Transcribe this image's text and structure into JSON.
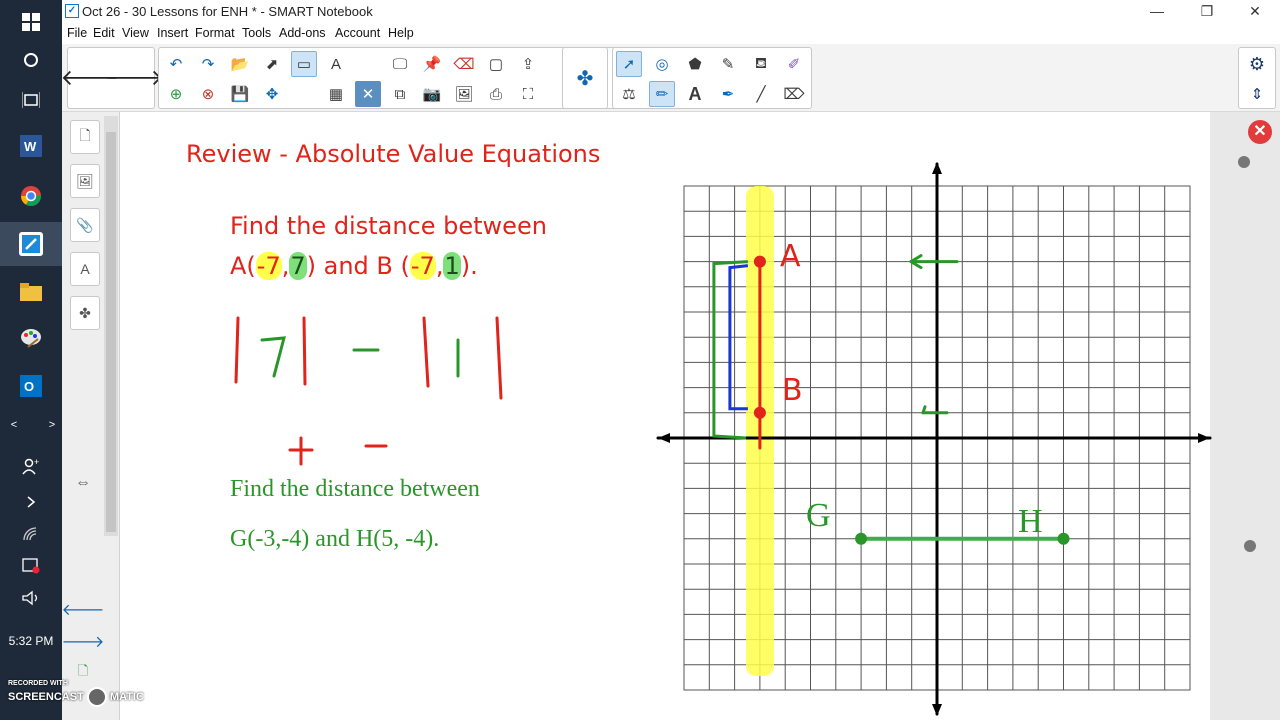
{
  "window": {
    "title": "Oct 26 - 30 Lessons for ENH * - SMART Notebook",
    "minimize": "—",
    "restore": "❐",
    "close": "✕"
  },
  "menu": [
    "File",
    "Edit",
    "View",
    "Insert",
    "Format",
    "Tools",
    "Add-ons",
    "Account",
    "Help"
  ],
  "taskbar": {
    "time": "5:32 PM"
  },
  "lesson": {
    "heading": "Review - Absolute Value Equations",
    "q1_line1": "Find the distance between",
    "q1_A_prefix": "A(",
    "q1_A_x": "-7",
    "q1_A_y": "7",
    "q1_A_mid": ") and B (",
    "q1_B_x": "-7",
    "q1_B_y": "1",
    "q1_B_suffix": ").",
    "q2_line1": "Find the distance between",
    "q2_line2": "G(-3,-4) and H(5, -4)."
  },
  "graph": {
    "point_labels": {
      "A": "A",
      "B": "B",
      "G": "G",
      "H": "H"
    },
    "points": {
      "A": [
        -7,
        7
      ],
      "B": [
        -7,
        1
      ],
      "G": [
        -3,
        -4
      ],
      "H": [
        5,
        -4
      ]
    },
    "x_range": [
      -10,
      10
    ],
    "y_range": [
      -10,
      10
    ]
  },
  "handwriting": {
    "abs1": "| 7 |",
    "minus": "–",
    "abs2": "| 1 |",
    "plus": "+",
    "minus2": "–"
  },
  "watermark": {
    "top": "RECORDED WITH",
    "brand": "SCREENCAST",
    "suffix": "MATIC"
  },
  "colors": {
    "red": "#e0231b",
    "green": "#2a962a",
    "blue": "#1a35d6",
    "highlight": "#ffff4a"
  }
}
